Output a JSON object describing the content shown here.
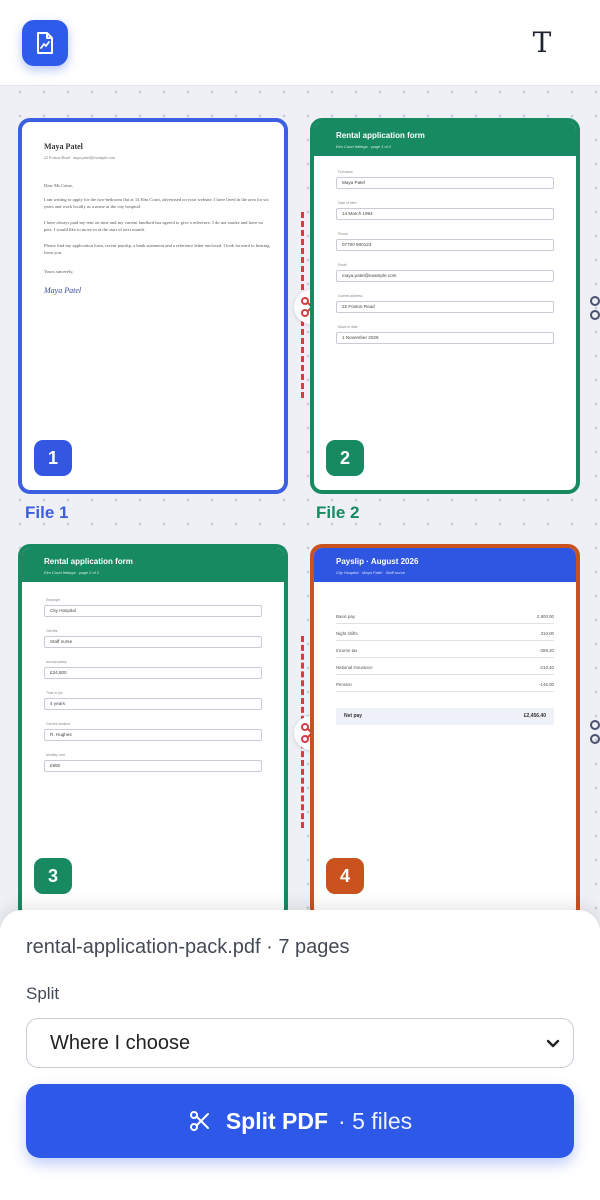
{
  "toolbar": {
    "app_icon": "pdf-chart-icon",
    "text_tool_glyph": "T"
  },
  "pages": [
    {
      "number": "1",
      "file_label": "File 1",
      "type": "letter",
      "letter": {
        "name": "Maya Patel",
        "address": "22 Foxton Road · maya.patel@example.com",
        "greeting": "Dear Ms Caine,",
        "p1": "I am writing to apply for the two-bedroom flat at 14 Elm Court, advertised on your website. I have lived in the area for six years and work locally as a nurse at the city hospital.",
        "p2": "I have always paid my rent on time and my current landlord has agreed to give a reference. I do not smoke and have no pets. I would like to move in at the start of next month.",
        "p3": "Please find my application form, recent payslip, a bank statement and a reference letter enclosed. I look forward to hearing from you.",
        "closing": "Yours sincerely,",
        "signature": "Maya Patel"
      }
    },
    {
      "number": "2",
      "file_label": "File 2",
      "type": "form",
      "form": {
        "title": "Rental application form",
        "subtitle": "Elm Court lettings · page 1 of 2",
        "fields": [
          {
            "label": "Full name",
            "value": "Maya Patel"
          },
          {
            "label": "Date of birth",
            "value": "14 March 1994"
          },
          {
            "label": "Phone",
            "value": "07700 900123"
          },
          {
            "label": "Email",
            "value": "maya.patel@example.com"
          },
          {
            "label": "Current address",
            "value": "22 Foxton Road"
          },
          {
            "label": "Move-in date",
            "value": "1 November 2026"
          }
        ]
      }
    },
    {
      "number": "3",
      "type": "form",
      "form": {
        "title": "Rental application form",
        "subtitle": "Elm Court lettings · page 2 of 2",
        "fields": [
          {
            "label": "Employer",
            "value": "City Hospital"
          },
          {
            "label": "Job title",
            "value": "Staff nurse"
          },
          {
            "label": "Annual salary",
            "value": "£34,800"
          },
          {
            "label": "Time in job",
            "value": "4 years"
          },
          {
            "label": "Current landlord",
            "value": "R. Hughes"
          },
          {
            "label": "Monthly rent",
            "value": "£950"
          }
        ]
      }
    },
    {
      "number": "4",
      "type": "payslip",
      "payslip": {
        "title": "Payslip · August 2026",
        "subtitle": "City Hospital · Maya Patel · Staff nurse",
        "rows": [
          {
            "label": "Basic pay",
            "value": "2,900.00"
          },
          {
            "label": "Night shifts",
            "value": "310.00"
          },
          {
            "label": "Income tax",
            "value": "-398.20"
          },
          {
            "label": "National Insurance",
            "value": "-210.40"
          },
          {
            "label": "Pension",
            "value": "-145.00"
          }
        ],
        "net_label": "Net pay",
        "net_value": "£2,456.40"
      }
    }
  ],
  "sheet": {
    "filename": "rental-application-pack.pdf",
    "separator": " · ",
    "page_count": "7 pages",
    "split_label": "Split",
    "split_value": "Where I choose",
    "button_label": "Split PDF",
    "button_count": "· 5 files"
  },
  "colors": {
    "blue": "#2f5bea",
    "green": "#178a62",
    "orange": "#c9521e",
    "cut_red": "#d23f3f"
  }
}
